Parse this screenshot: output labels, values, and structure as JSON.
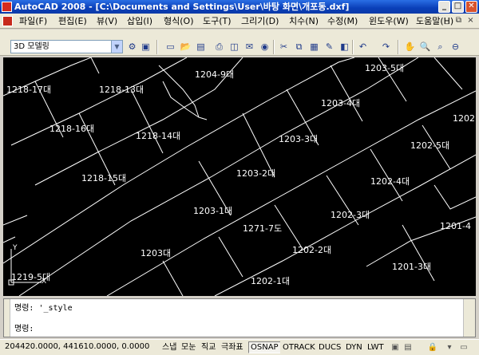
{
  "titlebar": {
    "title": "AutoCAD 2008 - [C:\\Documents and Settings\\User\\바탕 화면\\개포동.dxf]",
    "minimize": "_",
    "maximize": "□",
    "close": "✕"
  },
  "menu": {
    "items": [
      "파일(F)",
      "편집(E)",
      "뷰(V)",
      "삽입(I)",
      "형식(O)",
      "도구(T)",
      "그리기(D)",
      "치수(N)",
      "수정(M)",
      "윈도우(W)",
      "도움말(H)"
    ],
    "mdi_minimize": "_",
    "mdi_restore": "⧉",
    "mdi_close": "×"
  },
  "toolbar": {
    "workspace": "3D 모델링",
    "workspace_arrow": "▼",
    "icons": [
      "workspace-settings-icon",
      "toolbar-grip-icon",
      "new-icon",
      "open-icon",
      "save-icon",
      "plot-icon",
      "plot-preview-icon",
      "publish-icon",
      "3d-dwf-icon",
      "cut-icon",
      "copy-icon",
      "paste-icon",
      "match-properties-icon",
      "block-editor-icon",
      "undo-icon",
      "redo-icon",
      "pan-icon",
      "zoom-realtime-icon",
      "zoom-window-icon",
      "zoom-previous-icon"
    ]
  },
  "drawing": {
    "parcels": [
      "1204-9대",
      "1203-5대",
      "1218-17대",
      "1218-13대",
      "1203-4대",
      "1202",
      "1218-16대",
      "1218-14대",
      "1203-3대",
      "1202-5대",
      "1203-2대",
      "1218-15대",
      "1202-4대",
      "1203-1대",
      "1202-3대",
      "1271-7도",
      "1201-4",
      "1203대",
      "1202-2대",
      "1201-3대",
      "1219-5대",
      "1202-1대"
    ],
    "ucs": {
      "x_label": "X",
      "y_label": "Y"
    }
  },
  "command": {
    "line1_prompt": "명령:",
    "line1_text": "'_style",
    "line2_prompt": "명령:",
    "line2_text": ""
  },
  "status": {
    "coordinates": "204420.0000, 441610.0000, 0.0000",
    "toggles": [
      {
        "label": "스냅",
        "on": false
      },
      {
        "label": "모눈",
        "on": false
      },
      {
        "label": "직교",
        "on": false
      },
      {
        "label": "극좌표",
        "on": false
      },
      {
        "label": "OSNAP",
        "on": true
      },
      {
        "label": "OTRACK",
        "on": false
      },
      {
        "label": "DUCS",
        "on": false
      },
      {
        "label": "DYN",
        "on": false
      },
      {
        "label": "LWT",
        "on": false
      }
    ],
    "tray_icons": [
      "model-icon",
      "layout-icon",
      "lock-icon",
      "settings-icon",
      "maximize-icon"
    ]
  },
  "colors": {
    "titlebar": "#0a3fb8",
    "canvas": "#000000",
    "geometry": "#ffffff",
    "chrome": "#ece9d8"
  }
}
